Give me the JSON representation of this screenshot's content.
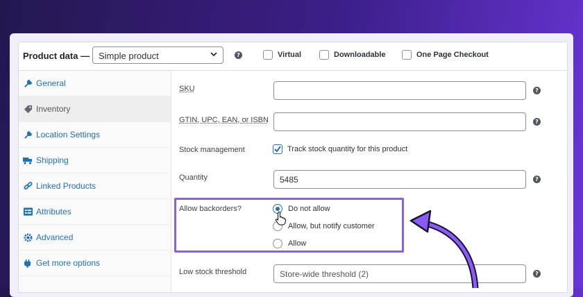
{
  "header": {
    "title": "Product data —",
    "product_type": "Simple product",
    "help": "?",
    "checks": [
      {
        "label": "Virtual"
      },
      {
        "label": "Downloadable"
      },
      {
        "label": "One Page Checkout"
      }
    ]
  },
  "sidebar": {
    "items": [
      {
        "label": "General",
        "icon": "wrench-icon"
      },
      {
        "label": "Inventory",
        "icon": "tag-icon"
      },
      {
        "label": "Location Settings",
        "icon": "wrench-icon"
      },
      {
        "label": "Shipping",
        "icon": "truck-icon"
      },
      {
        "label": "Linked Products",
        "icon": "link-icon"
      },
      {
        "label": "Attributes",
        "icon": "list-icon"
      },
      {
        "label": "Advanced",
        "icon": "gear-icon"
      },
      {
        "label": "Get more options",
        "icon": "plugin-icon"
      }
    ]
  },
  "fields": {
    "sku_label": "SKU",
    "sku_value": "",
    "gtin_label": "GTIN, UPC, EAN, or ISBN",
    "gtin_value": "",
    "stock_mgmt_label": "Stock management",
    "stock_mgmt_check": "Track stock quantity for this product",
    "quantity_label": "Quantity",
    "quantity_value": "5485",
    "backorders_label": "Allow backorders?",
    "backorders_options": [
      "Do not allow",
      "Allow, but notify customer",
      "Allow"
    ],
    "low_stock_label": "Low stock threshold",
    "low_stock_placeholder": "Store-wide threshold (2)"
  },
  "colors": {
    "accent": "#2271b1",
    "highlight": "#8a5cf6",
    "background_start": "#24174f",
    "background_end": "#6a35d6"
  }
}
